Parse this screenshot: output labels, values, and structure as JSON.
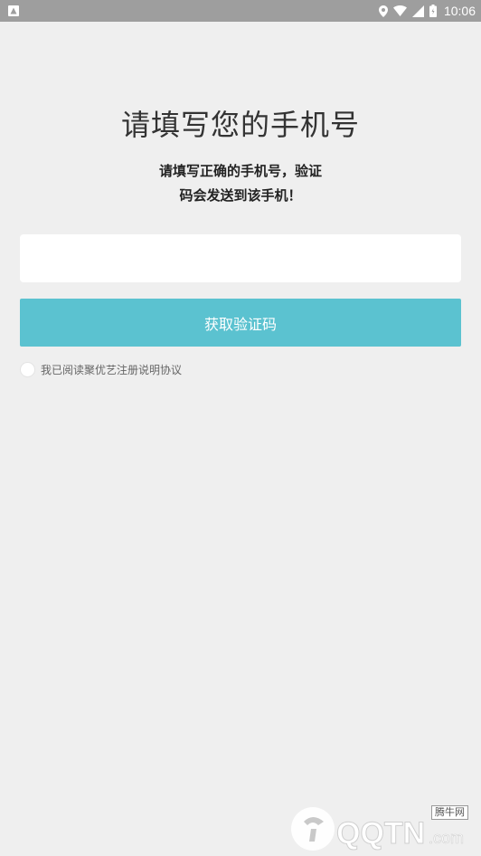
{
  "status_bar": {
    "time": "10:06",
    "icons": [
      "notification-icon",
      "location-icon",
      "wifi-icon",
      "signal-icon",
      "battery-icon"
    ]
  },
  "header": {
    "title": "请填写您的手机号",
    "subtitle_line1": "请填写正确的手机号，验证",
    "subtitle_line2": "码会发送到该手机！"
  },
  "form": {
    "phone_value": "",
    "phone_placeholder": "",
    "get_code_label": "获取验证码",
    "agreement_label": "我已阅读聚优艺注册说明协议",
    "agreement_checked": false
  },
  "watermark": {
    "logo_text": "QQTN",
    "domain_text": ".com",
    "tag_text": "腾牛网"
  },
  "colors": {
    "background": "#efefef",
    "accent": "#5bc2d0",
    "status_bar": "#9e9e9e"
  }
}
